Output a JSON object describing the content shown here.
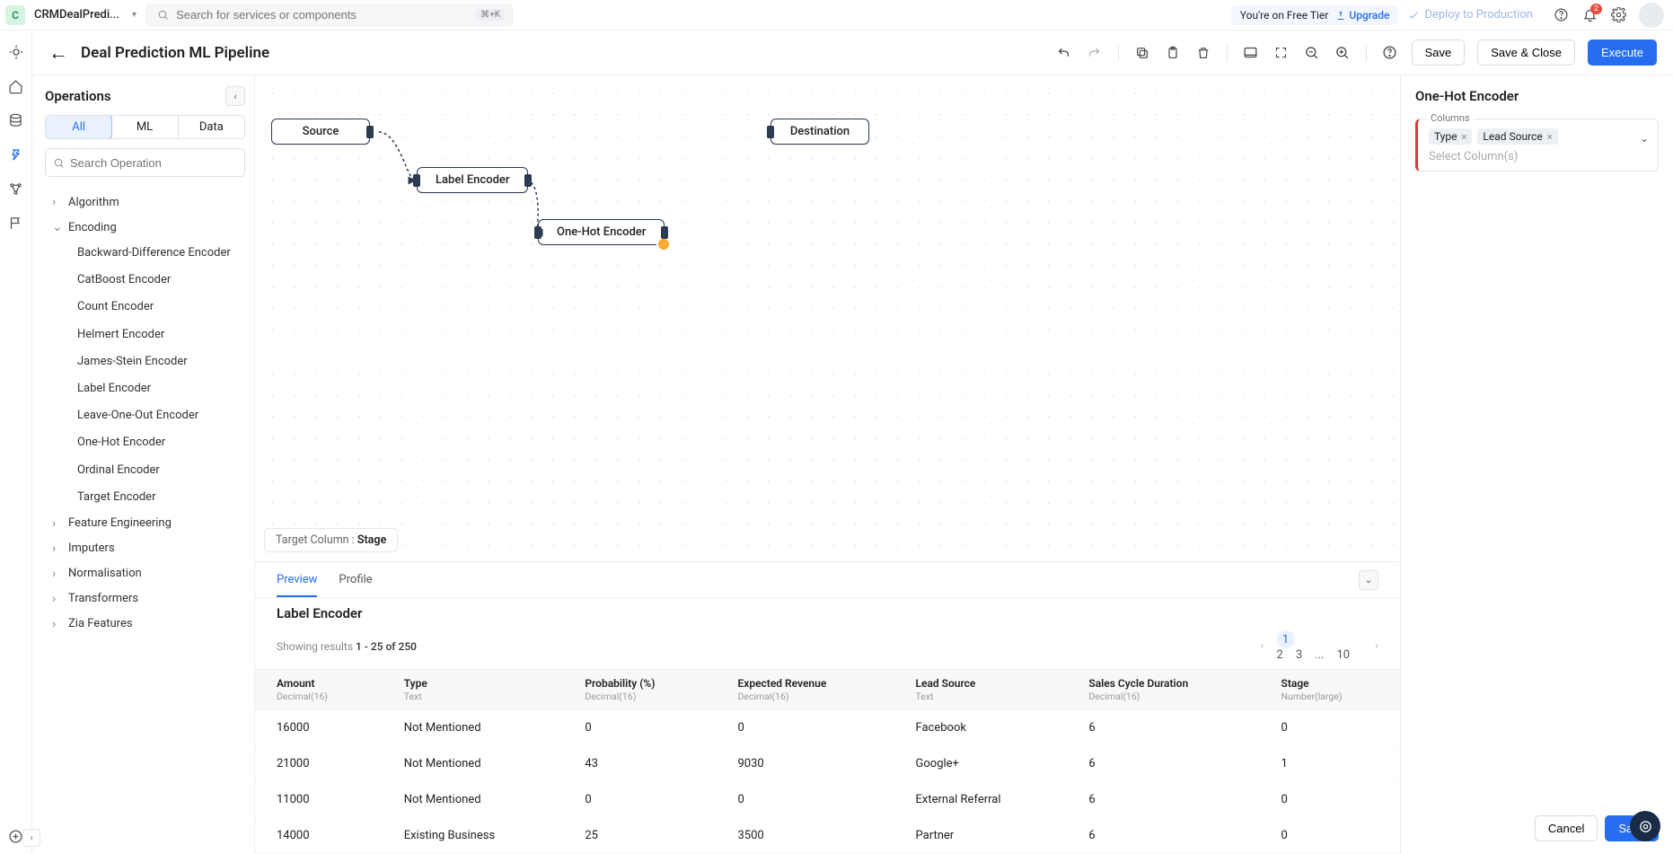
{
  "topbar": {
    "app_initial": "C",
    "project_name": "CRMDealPredi...",
    "search_placeholder": "Search for services or components",
    "kbd": "⌘+K",
    "tier_text": "You're on Free Tier",
    "upgrade": "Upgrade",
    "deploy": "Deploy to Production",
    "notif_count": "2"
  },
  "page": {
    "title": "Deal Prediction ML Pipeline",
    "save": "Save",
    "save_close": "Save & Close",
    "execute": "Execute"
  },
  "operations": {
    "heading": "Operations",
    "tabs": {
      "all": "All",
      "ml": "ML",
      "data": "Data"
    },
    "search_placeholder": "Search Operation",
    "cats": {
      "algorithm": "Algorithm",
      "encoding": "Encoding",
      "feature": "Feature Engineering",
      "imputers": "Imputers",
      "norm": "Normalisation",
      "transformers": "Transformers",
      "zia": "Zia Features"
    },
    "encoding_children": [
      "Backward-Difference Encoder",
      "CatBoost Encoder",
      "Count Encoder",
      "Helmert Encoder",
      "James-Stein Encoder",
      "Label Encoder",
      "Leave-One-Out Encoder",
      "One-Hot Encoder",
      "Ordinal Encoder",
      "Target Encoder"
    ]
  },
  "canvas": {
    "nodes": {
      "source": "Source",
      "label": "Label Encoder",
      "onehot": "One-Hot Encoder",
      "dest": "Destination"
    },
    "target_label": "Target Column :",
    "target_value": "Stage"
  },
  "right": {
    "heading": "One-Hot Encoder",
    "field_label": "Columns",
    "chips": [
      "Type",
      "Lead Source"
    ],
    "placeholder": "Select Column(s)",
    "cancel": "Cancel",
    "save": "Save"
  },
  "preview": {
    "tab_preview": "Preview",
    "tab_profile": "Profile",
    "heading": "Label Encoder",
    "showing_prefix": "Showing results",
    "showing_range": "1 - 25 of 250",
    "pages": [
      "1",
      "2",
      "3",
      "...",
      "10"
    ],
    "columns": [
      {
        "name": "Amount",
        "type": "Decimal(16)"
      },
      {
        "name": "Type",
        "type": "Text"
      },
      {
        "name": "Probability (%)",
        "type": "Decimal(16)"
      },
      {
        "name": "Expected Revenue",
        "type": "Decimal(16)"
      },
      {
        "name": "Lead Source",
        "type": "Text"
      },
      {
        "name": "Sales Cycle Duration",
        "type": "Decimal(16)"
      },
      {
        "name": "Stage",
        "type": "Number(large)"
      }
    ],
    "rows": [
      [
        "16000",
        "Not Mentioned",
        "0",
        "0",
        "Facebook",
        "6",
        "0"
      ],
      [
        "21000",
        "Not Mentioned",
        "43",
        "9030",
        "Google+",
        "6",
        "1"
      ],
      [
        "11000",
        "Not Mentioned",
        "0",
        "0",
        "External Referral",
        "6",
        "0"
      ],
      [
        "14000",
        "Existing Business",
        "25",
        "3500",
        "Partner",
        "6",
        "0"
      ]
    ]
  }
}
